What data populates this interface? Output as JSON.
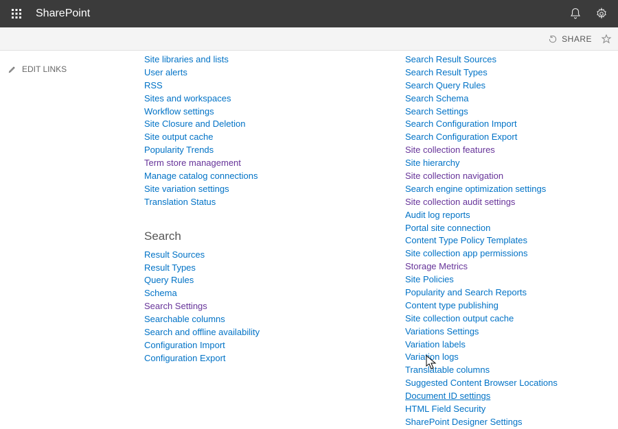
{
  "suite": {
    "brand": "SharePoint"
  },
  "actions": {
    "share": "SHARE"
  },
  "leftnav": {
    "edit_links": "EDIT LINKS"
  },
  "col1": {
    "group1": [
      {
        "label": "Site libraries and lists"
      },
      {
        "label": "User alerts"
      },
      {
        "label": "RSS"
      },
      {
        "label": "Sites and workspaces"
      },
      {
        "label": "Workflow settings"
      },
      {
        "label": "Site Closure and Deletion"
      },
      {
        "label": "Site output cache"
      },
      {
        "label": "Popularity Trends"
      },
      {
        "label": "Term store management",
        "visited": true
      },
      {
        "label": "Manage catalog connections"
      },
      {
        "label": "Site variation settings"
      },
      {
        "label": "Translation Status"
      }
    ],
    "group2_heading": "Search",
    "group2": [
      {
        "label": "Result Sources"
      },
      {
        "label": "Result Types"
      },
      {
        "label": "Query Rules"
      },
      {
        "label": "Schema"
      },
      {
        "label": "Search Settings",
        "visited": true
      },
      {
        "label": "Searchable columns"
      },
      {
        "label": "Search and offline availability"
      },
      {
        "label": "Configuration Import"
      },
      {
        "label": "Configuration Export"
      }
    ]
  },
  "col2": {
    "group1": [
      {
        "label": "Search Result Sources"
      },
      {
        "label": "Search Result Types"
      },
      {
        "label": "Search Query Rules"
      },
      {
        "label": "Search Schema"
      },
      {
        "label": "Search Settings"
      },
      {
        "label": "Search Configuration Import"
      },
      {
        "label": "Search Configuration Export"
      },
      {
        "label": "Site collection features",
        "visited": true
      },
      {
        "label": "Site hierarchy"
      },
      {
        "label": "Site collection navigation",
        "visited": true
      },
      {
        "label": "Search engine optimization settings"
      },
      {
        "label": "Site collection audit settings",
        "visited": true
      },
      {
        "label": "Audit log reports"
      },
      {
        "label": "Portal site connection"
      },
      {
        "label": "Content Type Policy Templates"
      },
      {
        "label": "Site collection app permissions"
      },
      {
        "label": "Storage Metrics",
        "visited": true
      },
      {
        "label": "Site Policies"
      },
      {
        "label": "Popularity and Search Reports"
      },
      {
        "label": "Content type publishing"
      },
      {
        "label": "Site collection output cache"
      },
      {
        "label": "Variations Settings"
      },
      {
        "label": "Variation labels"
      },
      {
        "label": "Variation logs"
      },
      {
        "label": "Translatable columns"
      },
      {
        "label": "Suggested Content Browser Locations"
      },
      {
        "label": "Document ID settings",
        "underlined": true
      },
      {
        "label": "HTML Field Security"
      },
      {
        "label": "SharePoint Designer Settings"
      }
    ]
  }
}
